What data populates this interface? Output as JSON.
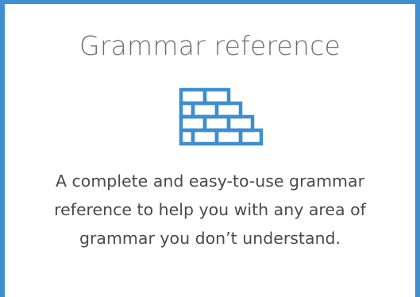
{
  "card": {
    "title": "Grammar reference",
    "icon": "brick-wall-icon",
    "description": "A complete and easy-to-use grammar reference to help you with any area of grammar you don’t understand.",
    "accent_color": "#3e8ed0"
  }
}
